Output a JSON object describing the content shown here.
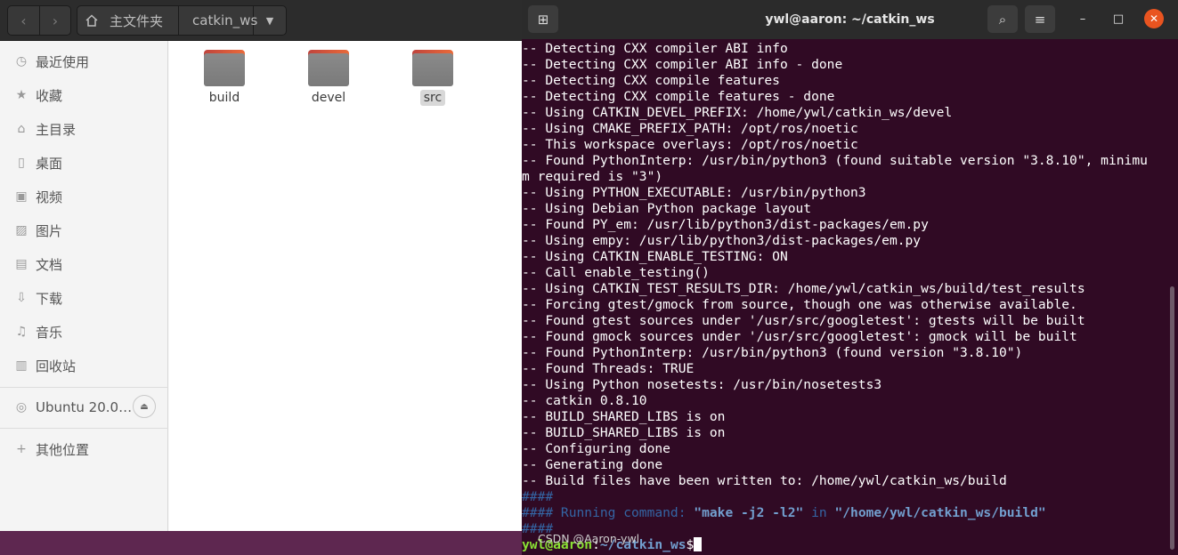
{
  "file_manager": {
    "nav": {
      "back": "‹",
      "forward": "›"
    },
    "path": {
      "home_label": "主文件夹",
      "current": "catkin_ws",
      "dropdown": "▼"
    },
    "sidebar": {
      "items": [
        {
          "label": "最近使用",
          "icon": "recent-icon",
          "glyph": "◷"
        },
        {
          "label": "收藏",
          "icon": "star-icon",
          "glyph": "★"
        },
        {
          "label": "主目录",
          "icon": "home-icon",
          "glyph": "⌂"
        },
        {
          "label": "桌面",
          "icon": "desktop-icon",
          "glyph": "▯"
        },
        {
          "label": "视频",
          "icon": "video-icon",
          "glyph": "▣"
        },
        {
          "label": "图片",
          "icon": "picture-icon",
          "glyph": "▨"
        },
        {
          "label": "文档",
          "icon": "document-icon",
          "glyph": "▤"
        },
        {
          "label": "下载",
          "icon": "download-icon",
          "glyph": "⇩"
        },
        {
          "label": "音乐",
          "icon": "music-icon",
          "glyph": "♫"
        },
        {
          "label": "回收站",
          "icon": "trash-icon",
          "glyph": "▥"
        }
      ],
      "drive": {
        "label": "Ubuntu 20.0…",
        "icon": "disc-icon",
        "glyph": "◎",
        "eject": "⏏"
      },
      "other": {
        "label": "其他位置",
        "icon": "plus-icon",
        "glyph": "+"
      }
    },
    "files": [
      {
        "name": "build",
        "selected": false
      },
      {
        "name": "devel",
        "selected": false
      },
      {
        "name": "src",
        "selected": true
      }
    ]
  },
  "terminal": {
    "title": "ywl@aaron: ~/catkin_ws",
    "buttons": {
      "new_tab": "⊞",
      "search": "⌕",
      "menu": "≡",
      "minimize": "–",
      "maximize": "□",
      "close": "✕"
    },
    "output": [
      "-- Detecting CXX compiler ABI info",
      "-- Detecting CXX compiler ABI info - done",
      "-- Detecting CXX compile features",
      "-- Detecting CXX compile features - done",
      "-- Using CATKIN_DEVEL_PREFIX: /home/ywl/catkin_ws/devel",
      "-- Using CMAKE_PREFIX_PATH: /opt/ros/noetic",
      "-- This workspace overlays: /opt/ros/noetic",
      "-- Found PythonInterp: /usr/bin/python3 (found suitable version \"3.8.10\", minimu",
      "m required is \"3\")",
      "-- Using PYTHON_EXECUTABLE: /usr/bin/python3",
      "-- Using Debian Python package layout",
      "-- Found PY_em: /usr/lib/python3/dist-packages/em.py",
      "-- Using empy: /usr/lib/python3/dist-packages/em.py",
      "-- Using CATKIN_ENABLE_TESTING: ON",
      "-- Call enable_testing()",
      "-- Using CATKIN_TEST_RESULTS_DIR: /home/ywl/catkin_ws/build/test_results",
      "-- Forcing gtest/gmock from source, though one was otherwise available.",
      "-- Found gtest sources under '/usr/src/googletest': gtests will be built",
      "-- Found gmock sources under '/usr/src/googletest': gmock will be built",
      "-- Found PythonInterp: /usr/bin/python3 (found version \"3.8.10\")",
      "-- Found Threads: TRUE",
      "-- Using Python nosetests: /usr/bin/nosetests3",
      "-- catkin 0.8.10",
      "-- BUILD_SHARED_LIBS is on",
      "-- BUILD_SHARED_LIBS is on",
      "-- Configuring done",
      "-- Generating done",
      "-- Build files have been written to: /home/ywl/catkin_ws/build"
    ],
    "hash_line": "####",
    "running_prefix": "#### Running command: ",
    "running_cmd": "\"make -j2 -l2\"",
    "running_in": " in ",
    "running_dir": "\"/home/ywl/catkin_ws/build\"",
    "prompt_user": "ywl@aaron",
    "prompt_sep": ":",
    "prompt_path": "~/catkin_ws",
    "prompt_symbol": "$"
  },
  "watermark": "CSDN @Aaron-ywl"
}
